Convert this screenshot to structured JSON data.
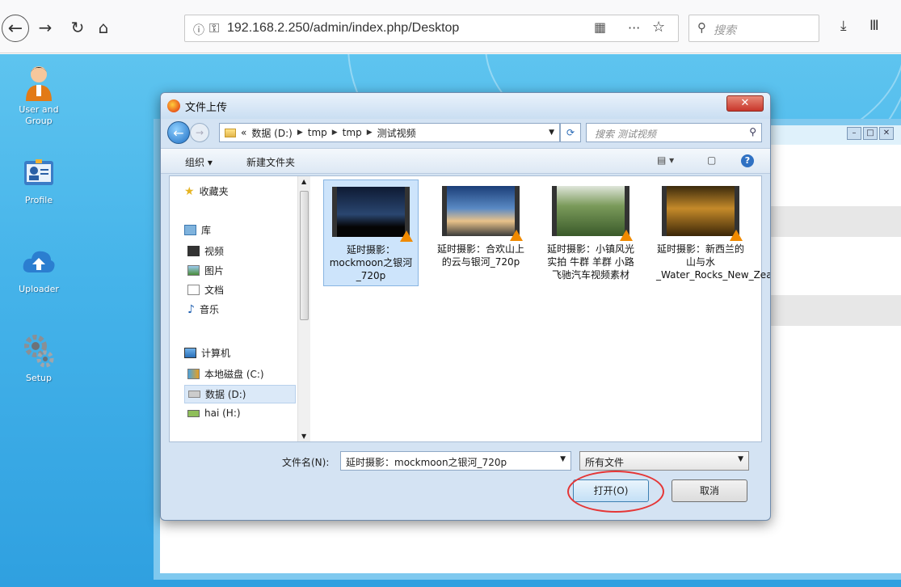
{
  "browser": {
    "url_prefix": "192.168.2.250",
    "url_path": "/admin/index.php/Desktop",
    "search_placeholder": "搜索"
  },
  "desktop": {
    "icons": [
      {
        "label": "User and Group",
        "icon": "user-group-icon"
      },
      {
        "label": "Profile",
        "icon": "profile-card-icon"
      },
      {
        "label": "Uploader",
        "icon": "cloud-upload-icon"
      },
      {
        "label": "Setup",
        "icon": "gears-icon"
      }
    ]
  },
  "dialog": {
    "title": "文件上传",
    "breadcrumb": [
      "«",
      "数据 (D:)",
      "tmp",
      "tmp",
      "测试视频"
    ],
    "search_placeholder": "搜索 测试视频",
    "organize": "组织 ▾",
    "new_folder": "新建文件夹",
    "nav": {
      "favorites": "收藏夹",
      "libraries": "库",
      "lib_items": [
        "视频",
        "图片",
        "文档",
        "音乐"
      ],
      "computer": "计算机",
      "drives": [
        "本地磁盘 (C:)",
        "数据 (D:)",
        "hai (H:)"
      ]
    },
    "files": [
      {
        "name": "延时摄影：mockmoon之银河_720p",
        "selected": true
      },
      {
        "name": "延时摄影：合欢山上的云与银河_720p",
        "selected": false
      },
      {
        "name": "延时摄影：小镇风光实拍 牛群 羊群 小路飞驰汽车视频素材",
        "selected": false
      },
      {
        "name": "延时摄影：新西兰的山与水_Water_Rocks_New_Zeala",
        "selected": false
      }
    ],
    "filename_label": "文件名(N):",
    "filename_value": "延时摄影：mockmoon之银河_720p",
    "filetype_value": "所有文件",
    "open_button": "打开(O)",
    "cancel_button": "取消"
  },
  "colors": {
    "desktop_bg": "#46b4ea",
    "highlight_ring": "#e53636"
  }
}
